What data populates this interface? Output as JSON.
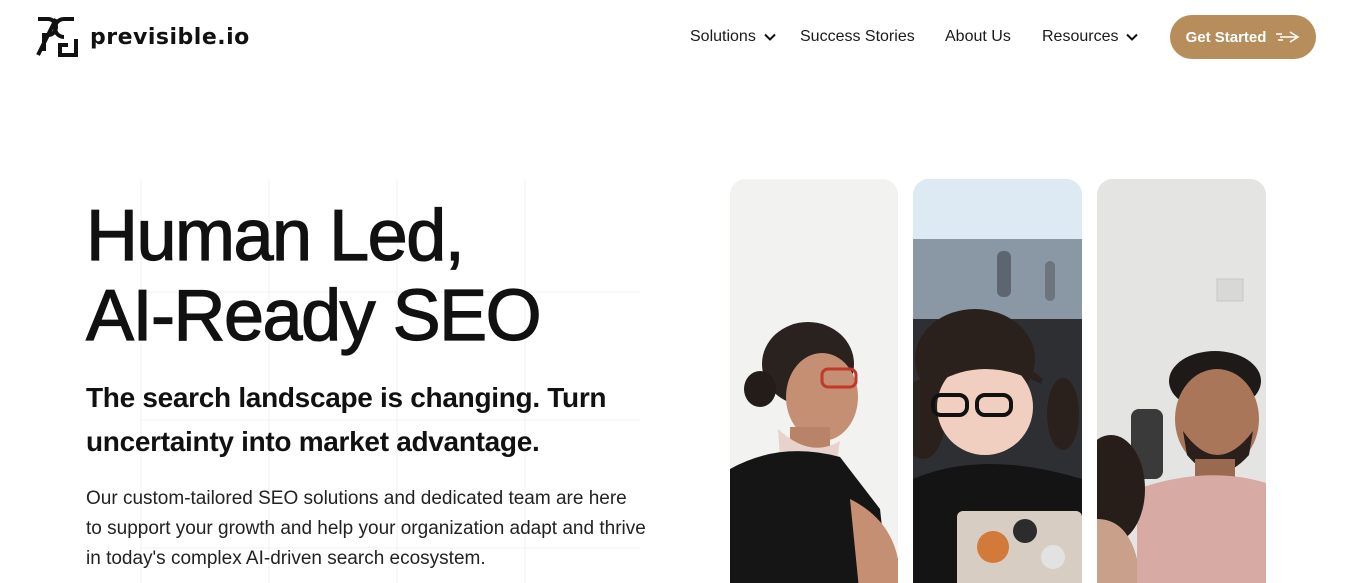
{
  "brand": {
    "name": "previsible.io",
    "logo_icon": "pg-monogram-icon"
  },
  "nav": {
    "solutions": "Solutions",
    "success_stories": "Success Stories",
    "about_us": "About Us",
    "resources": "Resources"
  },
  "cta": {
    "label": "Get Started",
    "icon": "paper-plane-arrow-icon"
  },
  "hero": {
    "title_line1": "Human Led,",
    "title_line2": "AI-Ready SEO",
    "subtitle": "The search landscape is changing. Turn uncertainty into market advantage.",
    "body": "Our custom-tailored SEO solutions and dedicated team are here to support your growth and help your organization adapt and thrive in today's complex AI-driven search ecosystem."
  },
  "colors": {
    "accent": "#b78d5b",
    "text": "#111111",
    "background": "#ffffff"
  }
}
